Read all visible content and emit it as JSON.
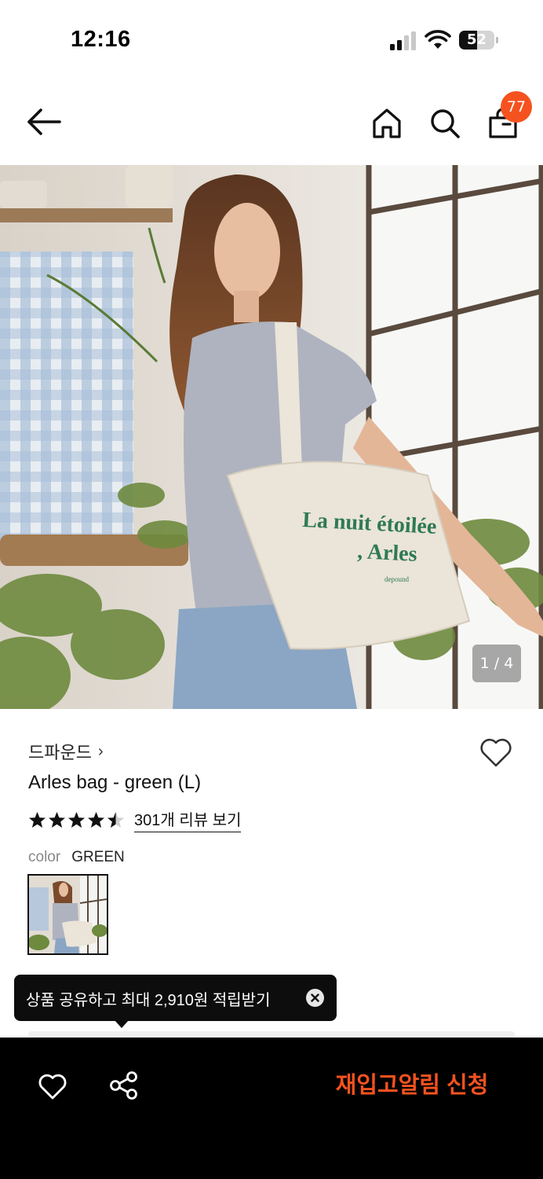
{
  "status_bar": {
    "time": "12:16",
    "battery": "52",
    "battery_level": 0.52
  },
  "header": {
    "cart_count": "77"
  },
  "hero": {
    "counter": "1 / 4",
    "bag_text_line1": "La nuit étoilée",
    "bag_text_line2": ", Arles",
    "bag_text_line3": "depound"
  },
  "product": {
    "brand": "드파운드",
    "brand_chevron": "›",
    "name": "Arles bag - green (L)",
    "rating": 4.5,
    "review_link": "301개 리뷰 보기",
    "color_label": "color",
    "color_value": "GREEN"
  },
  "tooltip": {
    "text": "상품 공유하고 최대 2,910원 적립받기"
  },
  "bottom_bar": {
    "restock_label": "재입고알림 신청"
  },
  "colors": {
    "accent": "#f5521f",
    "bag_print": "#2f7a55",
    "bottom_bar": "#000000"
  }
}
